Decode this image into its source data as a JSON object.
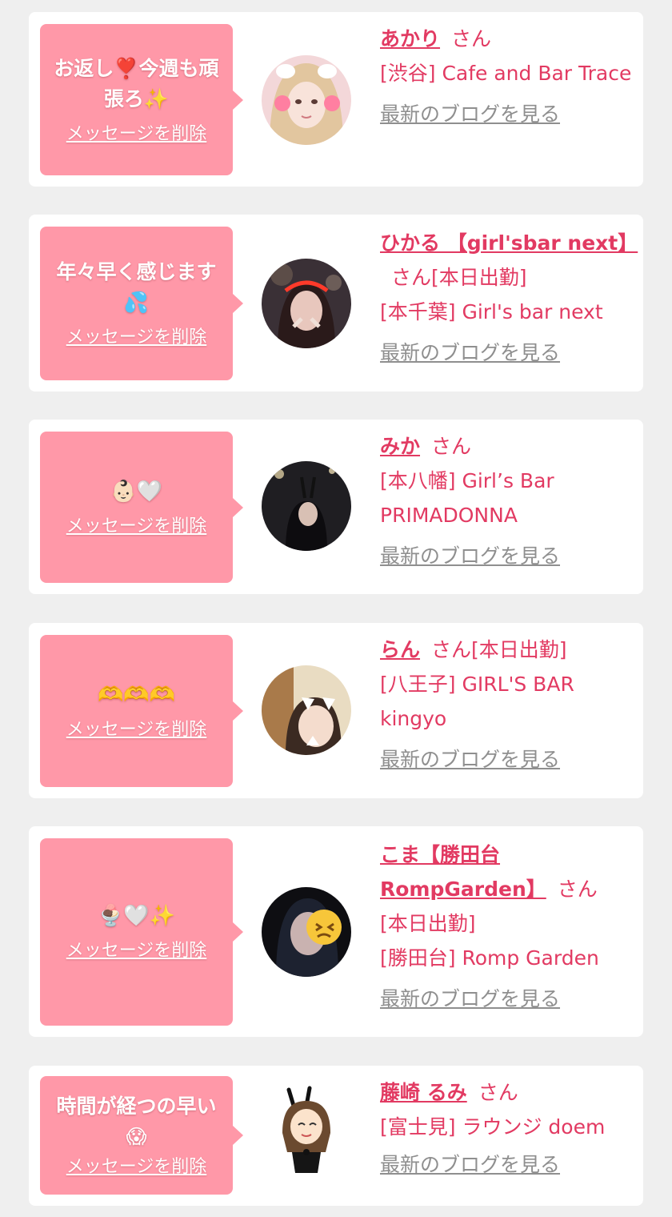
{
  "delete_label": "メッセージを削除",
  "blog_label": "最新のブログを見る",
  "honorific": "さん",
  "colors": {
    "accent": "#e23a62",
    "bubble": "#ff98a8",
    "link_gray": "#8f8f8f",
    "background": "#efefef"
  },
  "items": [
    {
      "message": "お返し❣️今週も頑張ろ✨",
      "name": "あかり",
      "status": "",
      "shop": "[渋谷] Cafe and Bar Trace",
      "avatar_icon": "girl-photo-avatar"
    },
    {
      "message": "年々早く感じます💦",
      "name": "ひかる 【girl'sbar next】",
      "status": "[本日出勤]",
      "shop": "[本千葉] Girl's bar next",
      "avatar_icon": "girl-photo-avatar"
    },
    {
      "message": "👶🏻🤍",
      "name": "みか",
      "status": "",
      "shop": "[本八幡] Girl’s Bar PRIMADONNA",
      "avatar_icon": "girl-photo-avatar"
    },
    {
      "message": "🫶🫶🫶",
      "name": "らん",
      "status": "[本日出勤]",
      "shop": "[八王子] GIRL'S BAR kingyo",
      "avatar_icon": "girl-photo-avatar"
    },
    {
      "message": "🍨🤍✨",
      "name": "こま【勝田台RompGarden】",
      "status": "[本日出勤]",
      "shop": "[勝田台] Romp Garden",
      "avatar_icon": "girl-photo-avatar"
    },
    {
      "message": "時間が経つの早い😱",
      "name": "藤崎 るみ",
      "status": "",
      "shop": "[富士見] ラウンジ doem",
      "avatar_icon": "bunny-girl-illustration"
    }
  ]
}
